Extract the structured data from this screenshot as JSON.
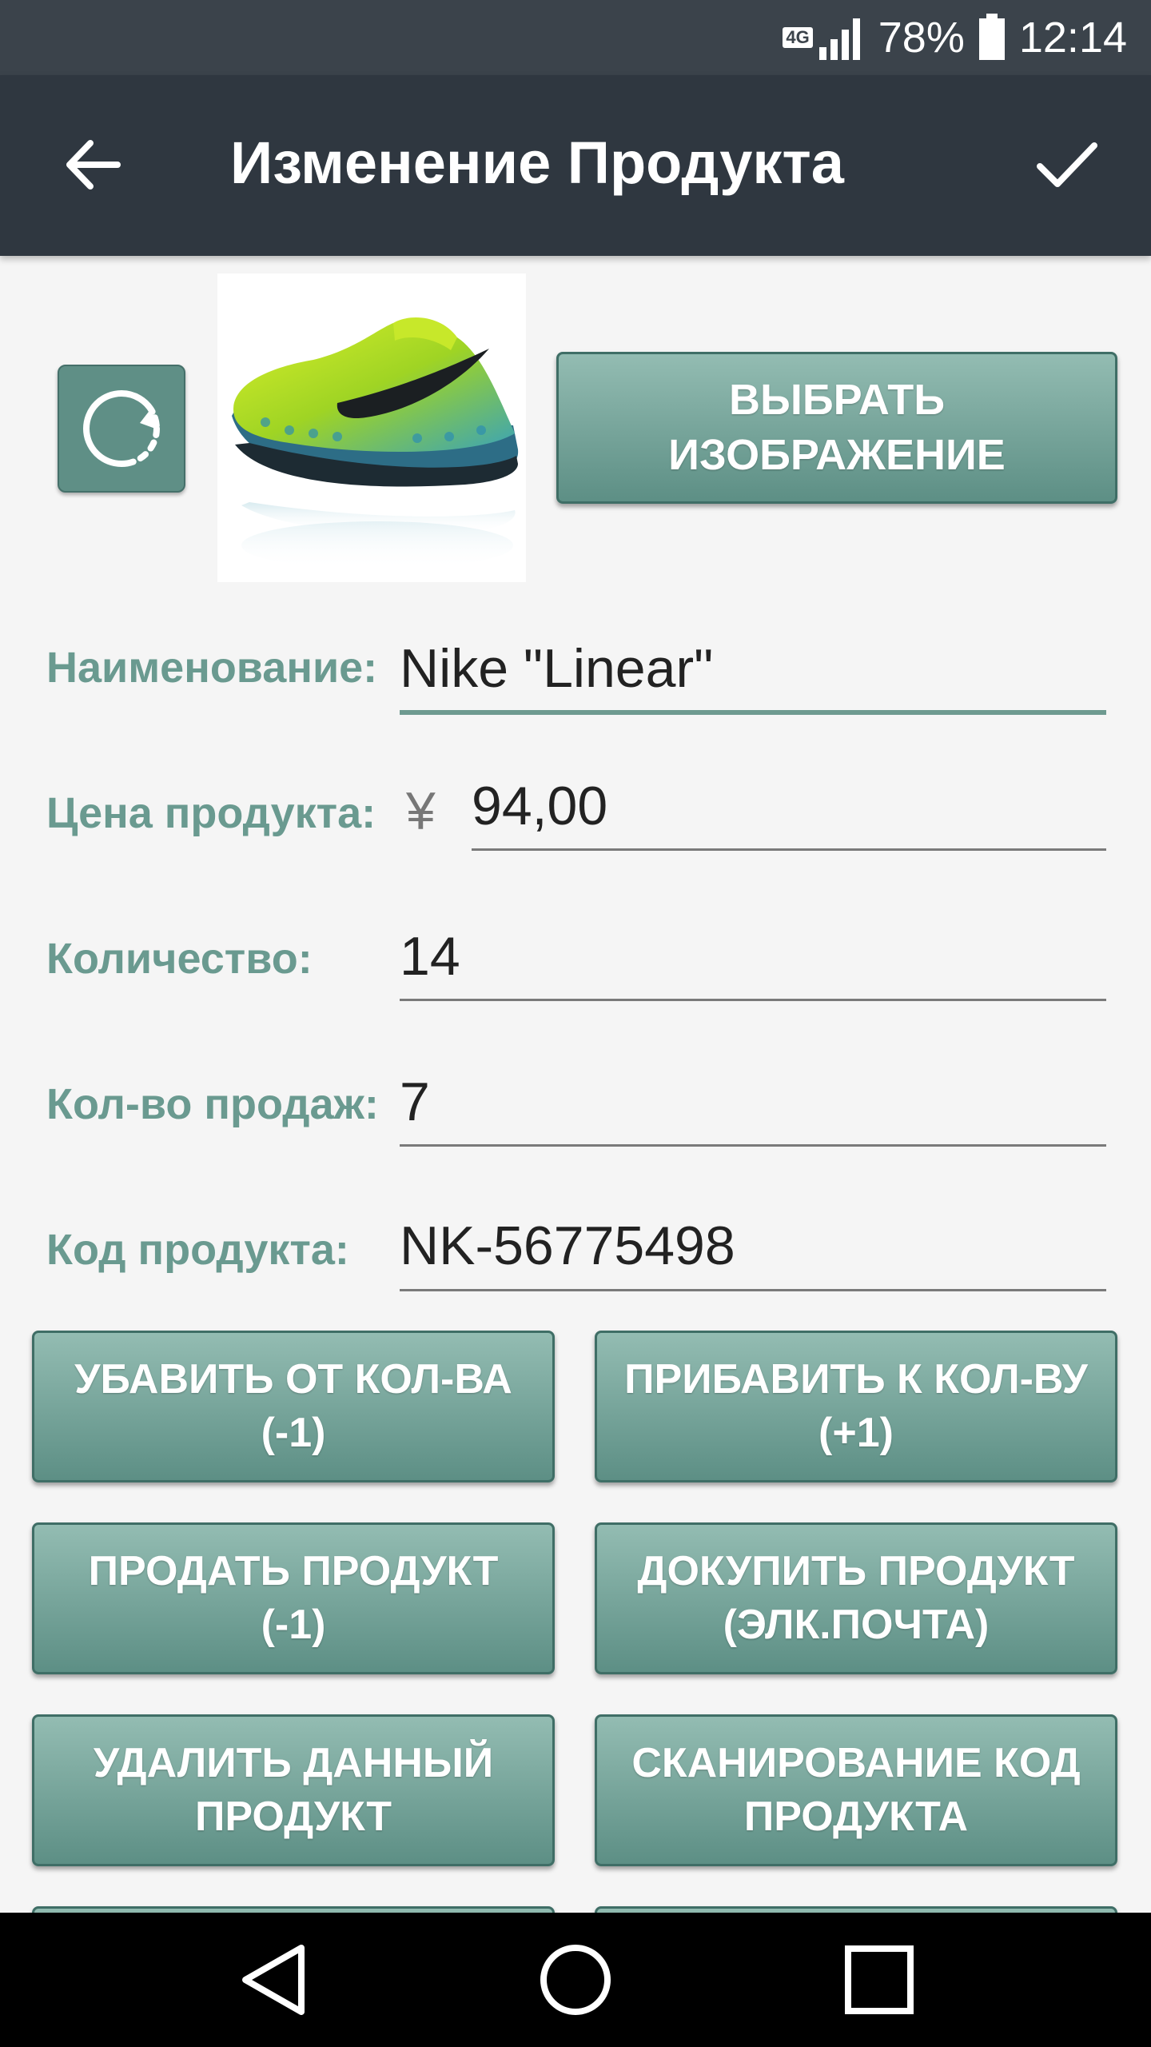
{
  "status_bar": {
    "network": "4G",
    "battery": "78%",
    "time": "12:14"
  },
  "app_bar": {
    "title": "Изменение Продукта",
    "back_icon": "arrow-left-icon",
    "confirm_icon": "checkmark-icon"
  },
  "image_section": {
    "rotate_icon": "rotate-icon",
    "product_image": "green-running-shoe",
    "pick_image_label": "ВЫБРАТЬ ИЗОБРАЖЕНИЕ"
  },
  "form": {
    "name": {
      "label": "Наименование:",
      "value": "Nike \"Linear\""
    },
    "price": {
      "label": "Цена продукта:",
      "currency": "¥",
      "value": "94,00"
    },
    "quantity": {
      "label": "Количество:",
      "value": "14"
    },
    "sales": {
      "label": "Кол-во продаж:",
      "value": "7"
    },
    "code": {
      "label": "Код продукта:",
      "value": "NK-56775498"
    }
  },
  "buttons": [
    {
      "line1": "УБАВИТЬ ОТ КОЛ-ВА",
      "line2": "(-1)"
    },
    {
      "line1": "ПРИБАВИТЬ К КОЛ-ВУ",
      "line2": "(+1)"
    },
    {
      "line1": "ПРОДАТЬ ПРОДУКТ",
      "line2": "(-1)"
    },
    {
      "line1": "ДОКУПИТЬ ПРОДУКТ",
      "line2": "(ЭЛК.ПОЧТА)"
    },
    {
      "line1": "УДАЛИТЬ ДАННЫЙ",
      "line2": "ПРОДУКТ"
    },
    {
      "line1": "СКАНИРОВАНИЕ КОД",
      "line2": "ПРОДУКТА"
    }
  ],
  "nav_bar": {
    "back_icon": "nav-back-triangle-icon",
    "home_icon": "nav-home-circle-icon",
    "recents_icon": "nav-recents-square-icon"
  },
  "colors": {
    "app_bar": "#2f3740",
    "status_bar": "#3b434b",
    "accent": "#6e9a90",
    "button_top": "#93bcb2",
    "button_bottom": "#5d8f85"
  }
}
